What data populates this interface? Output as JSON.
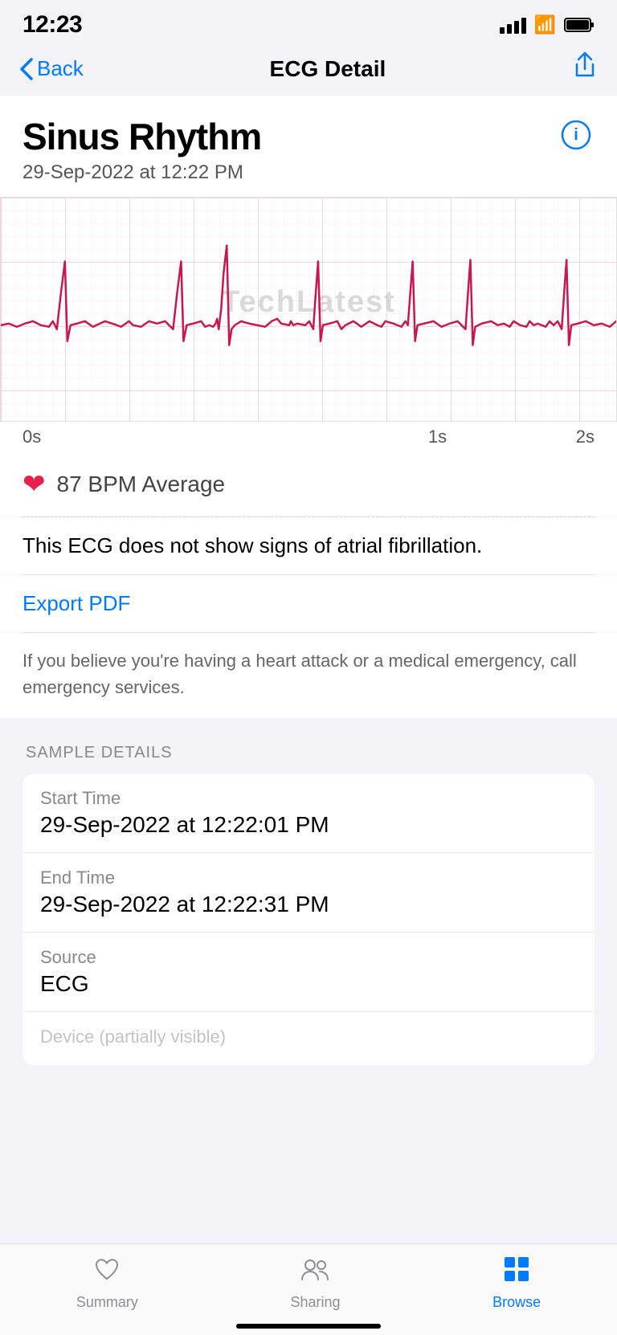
{
  "statusBar": {
    "time": "12:23"
  },
  "navBar": {
    "backLabel": "Back",
    "title": "ECG Detail",
    "shareIcon": "↑"
  },
  "diagnosis": {
    "title": "Sinus Rhythm",
    "date": "29-Sep-2022 at 12:22 PM",
    "watermark": "TechLatest"
  },
  "ecgChart": {
    "timeLabels": [
      "0s",
      "1s",
      "2s"
    ]
  },
  "bpm": {
    "value": "87 BPM Average"
  },
  "notice": {
    "text": "This ECG does not show signs of atrial fibrillation."
  },
  "exportPdf": {
    "label": "Export PDF"
  },
  "emergency": {
    "text": "If you believe you're having a heart attack or a medical emergency, call emergency services."
  },
  "sampleDetails": {
    "sectionLabel": "SAMPLE DETAILS",
    "rows": [
      {
        "label": "Start Time",
        "value": "29-Sep-2022 at 12:22:01 PM"
      },
      {
        "label": "End Time",
        "value": "29-Sep-2022 at 12:22:31 PM"
      },
      {
        "label": "Source",
        "value": "ECG"
      },
      {
        "label": "Device (partially visible)",
        "value": ""
      }
    ]
  },
  "tabBar": {
    "items": [
      {
        "label": "Summary",
        "active": false
      },
      {
        "label": "Sharing",
        "active": false
      },
      {
        "label": "Browse",
        "active": true
      }
    ]
  }
}
